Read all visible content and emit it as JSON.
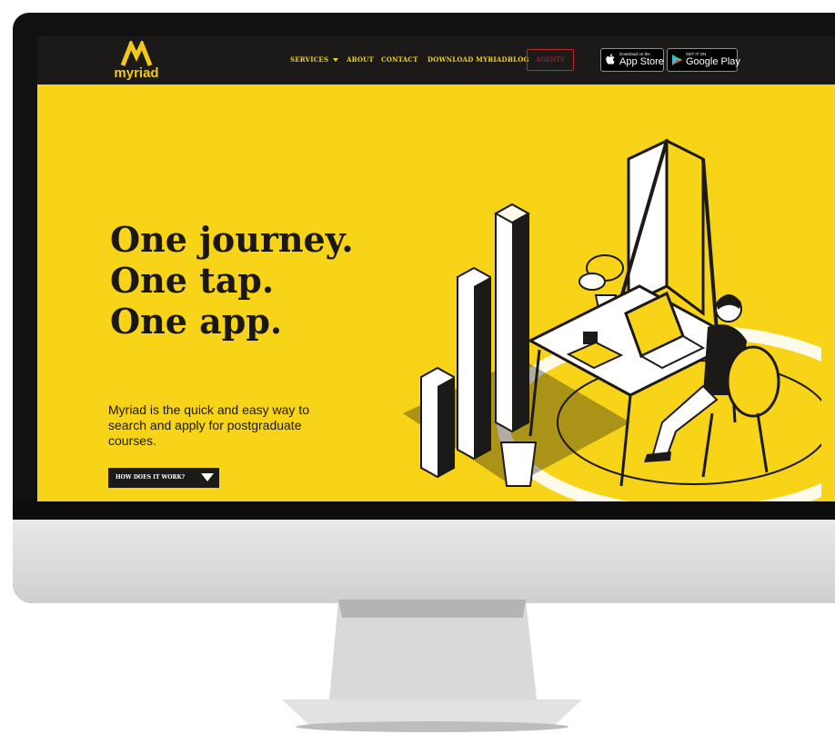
{
  "brand": {
    "name": "myriad"
  },
  "nav": {
    "items": [
      {
        "label": "SERVICES",
        "has_dropdown": true
      },
      {
        "label": "ABOUT"
      },
      {
        "label": "CONTACT"
      },
      {
        "label": "DOWNLOAD MYRIAD"
      },
      {
        "label": "BLOG"
      }
    ],
    "agents_label": "AGENTS",
    "app_store": {
      "small": "Download on the",
      "large": "App Store",
      "icon": "apple-icon"
    },
    "google_play": {
      "small": "GET IT ON",
      "large": "Google Play",
      "icon": "google-play-icon"
    }
  },
  "hero": {
    "title_lines": [
      "One journey.",
      "One tap.",
      "One app."
    ],
    "description": "Myriad is the quick and easy way to search and apply for postgraduate courses.",
    "cta_label": "HOW DOES IT WORK?",
    "cta_icon": "caret-down-icon"
  },
  "colors": {
    "hero_background": "#f7d417",
    "navbar": "#1c1a18",
    "nav_text": "#f4d21a",
    "agents_border": "#c3292b",
    "text": "#1a1817"
  }
}
